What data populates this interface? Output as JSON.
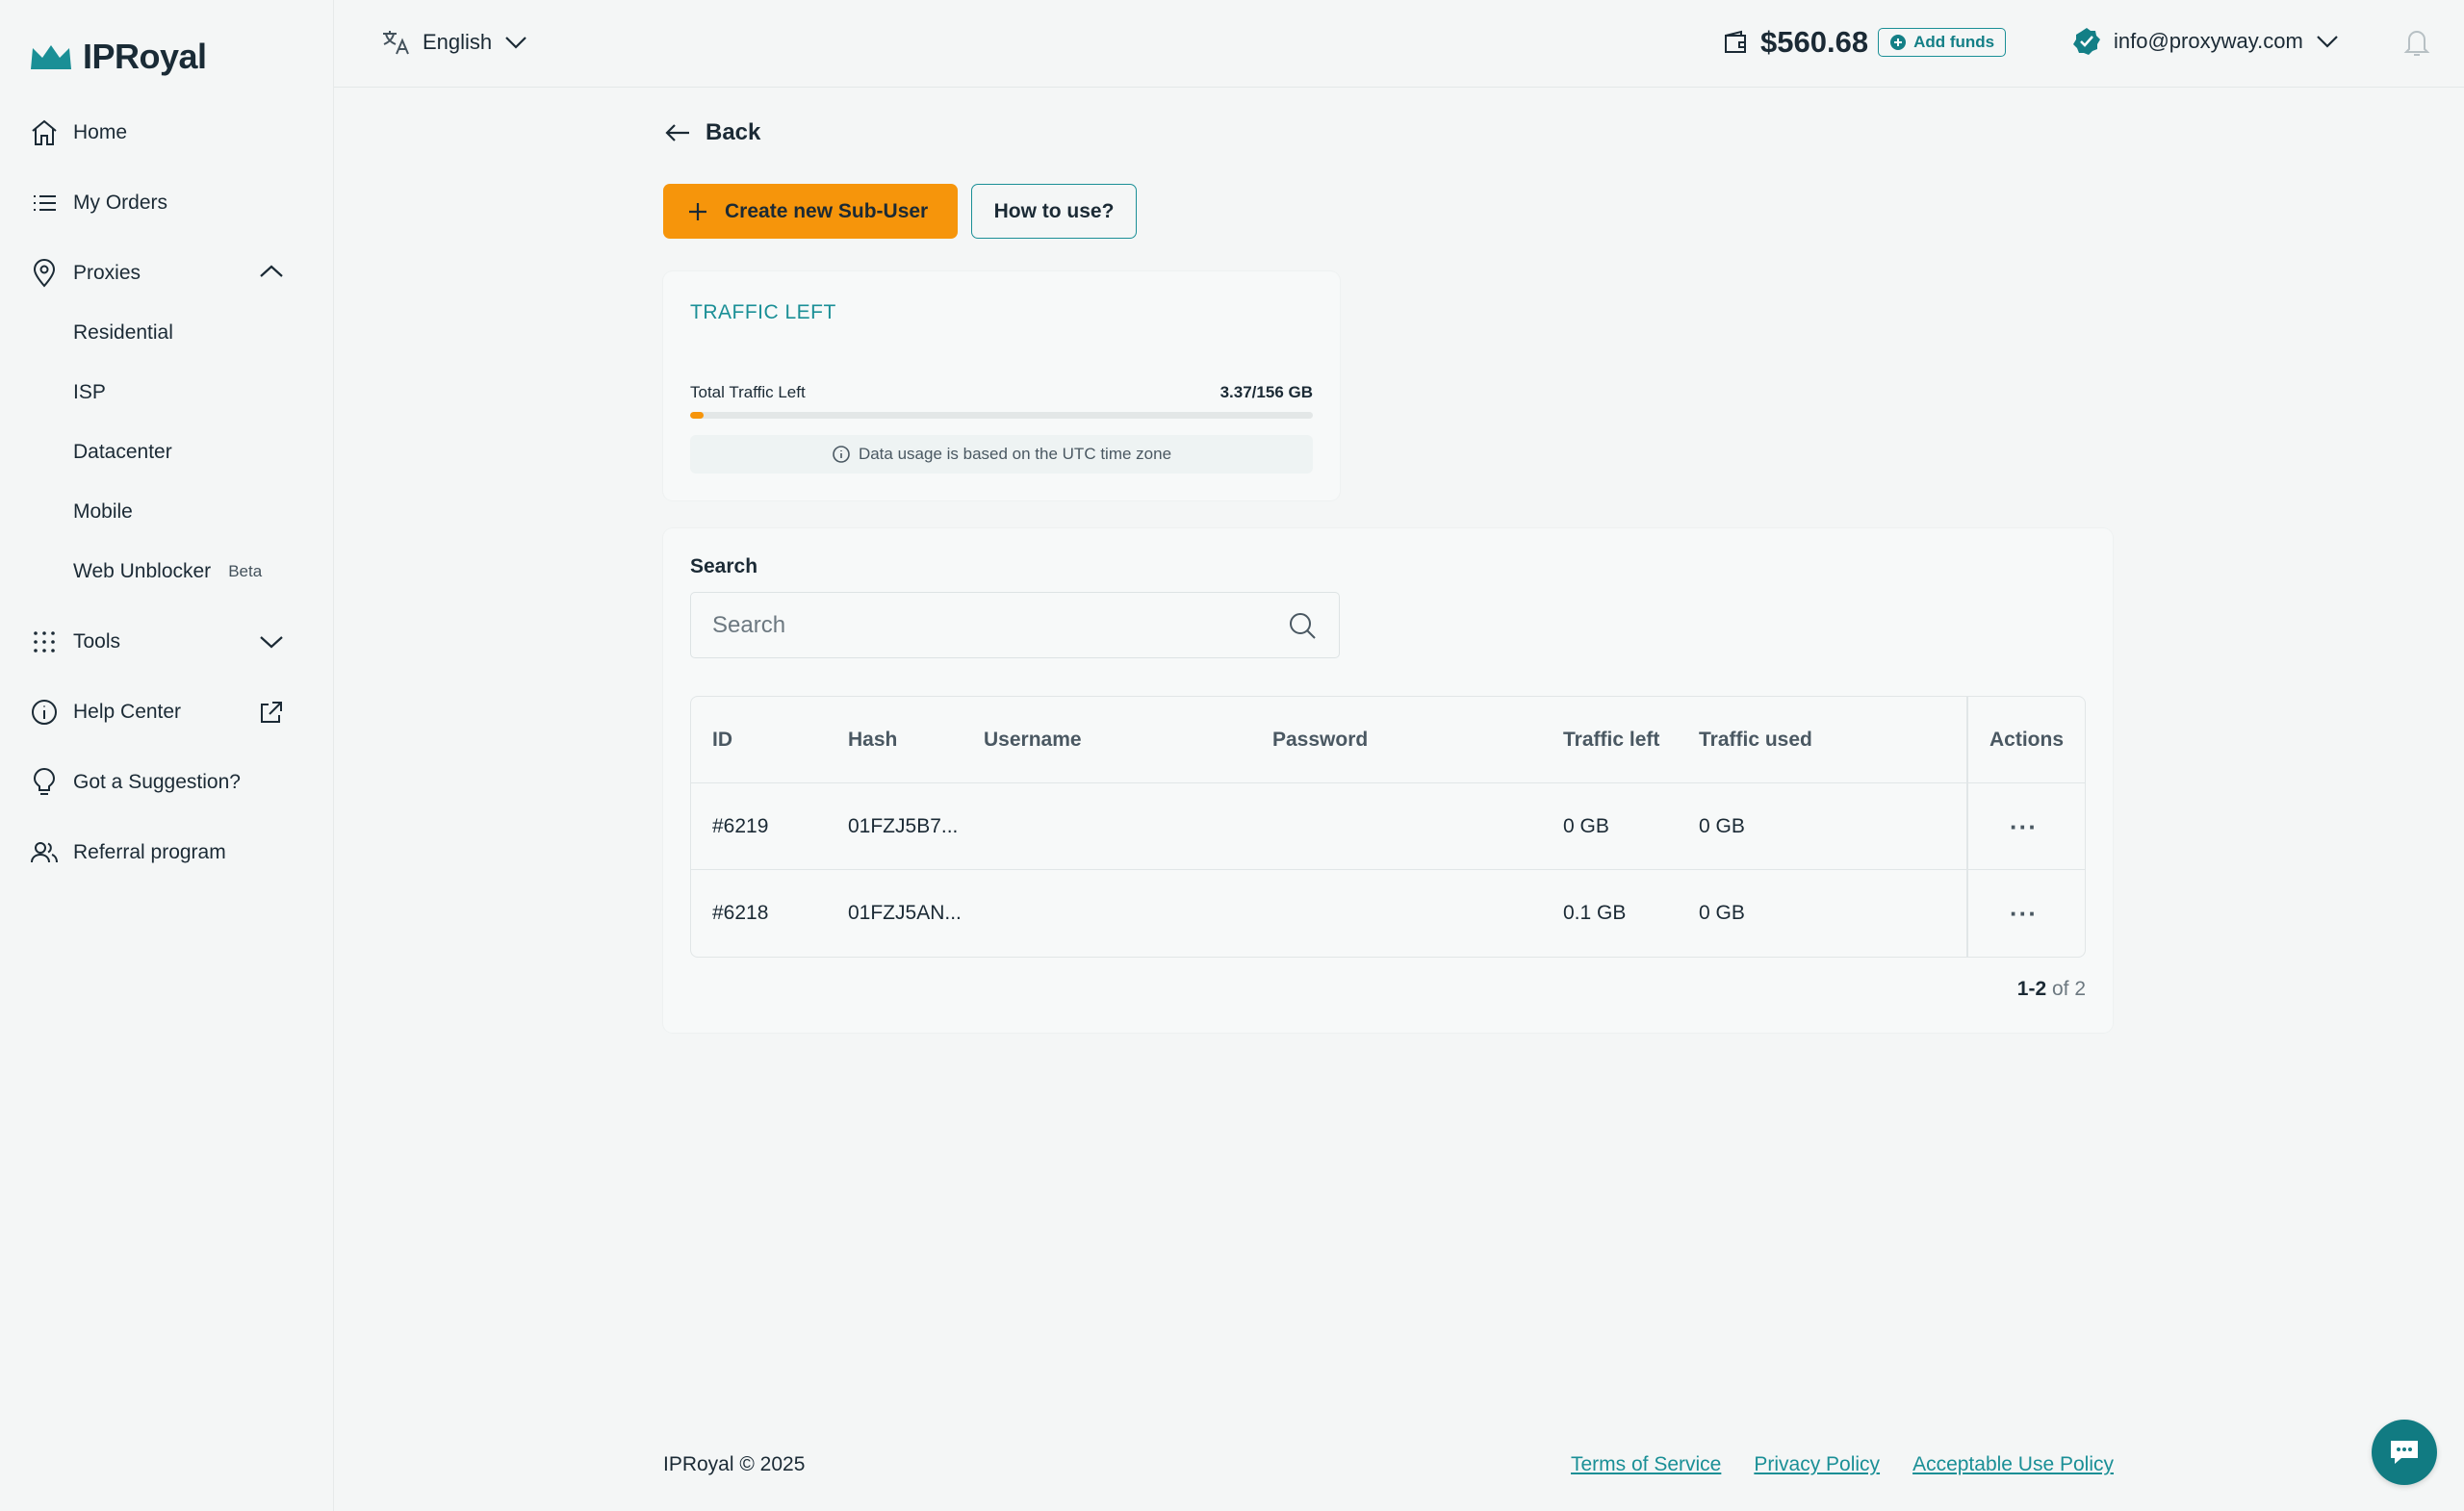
{
  "brand": {
    "name": "IPRoyal",
    "color": "#1a8f96",
    "accent": "#f6950b"
  },
  "sidebar": {
    "items": [
      {
        "label": "Home",
        "icon": "home-icon"
      },
      {
        "label": "My Orders",
        "icon": "list-icon"
      },
      {
        "label": "Proxies",
        "icon": "location-pin-icon"
      },
      {
        "label": "Tools",
        "icon": "grid-dots-icon"
      },
      {
        "label": "Help Center",
        "icon": "info-icon"
      },
      {
        "label": "Got a Suggestion?",
        "icon": "lightbulb-icon"
      },
      {
        "label": "Referral program",
        "icon": "users-icon"
      }
    ],
    "proxies_sub": [
      "Residential",
      "ISP",
      "Datacenter",
      "Mobile",
      "Web Unblocker"
    ],
    "beta_label": "Beta"
  },
  "topbar": {
    "language": "English",
    "balance": "$560.68",
    "add_funds": "Add funds",
    "user_email": "info@proxyway.com"
  },
  "main": {
    "back_label": "Back",
    "create_button": "Create new Sub-User",
    "how_button": "How to use?",
    "traffic": {
      "title": "TRAFFIC LEFT",
      "label": "Total Traffic Left",
      "value": "3.37/156 GB",
      "fill_fraction": 0.0216,
      "note": "Data usage is based on the UTC time zone"
    },
    "search": {
      "label": "Search",
      "placeholder": "Search"
    },
    "table": {
      "columns": [
        "ID",
        "Hash",
        "Username",
        "Password",
        "Traffic left",
        "Traffic used",
        "Actions"
      ],
      "rows": [
        {
          "id": "#6219",
          "hash": "01FZJ5B7...",
          "username": "",
          "password": "",
          "traffic_left": "0 GB",
          "traffic_used": "0 GB",
          "actions": "···"
        },
        {
          "id": "#6218",
          "hash": "01FZJ5AN...",
          "username": "",
          "password": "",
          "traffic_left": "0.1 GB",
          "traffic_used": "0 GB",
          "actions": "···"
        }
      ]
    },
    "pager": {
      "range": "1-2",
      "of": "of 2"
    }
  },
  "footer": {
    "copyright": "IPRoyal © 2025",
    "links": [
      "Terms of Service",
      "Privacy Policy",
      "Acceptable Use Policy"
    ]
  }
}
